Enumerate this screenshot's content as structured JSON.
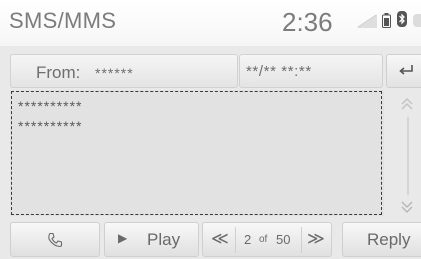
{
  "status_bar": {
    "title": "SMS/MMS",
    "clock": "2:36",
    "signal_icon": "signal-strength-icon",
    "battery_icon": "phone-battery-icon",
    "bluetooth_icon": "bluetooth-icon",
    "bluetooth_glyph": "ʙ"
  },
  "header": {
    "from_label": "From:",
    "from_value": "******",
    "time_value": "**/** **:**",
    "back_icon": "back-arrow-icon"
  },
  "message": {
    "lines": [
      "**********",
      "**********"
    ]
  },
  "scroll": {
    "up_icon": "scroll-up-icon",
    "down_icon": "scroll-down-icon"
  },
  "controls": {
    "call_icon": "phone-handset-icon",
    "play_label": "Play",
    "prev_label": "≪",
    "page_current": "2",
    "page_of": "of",
    "page_total": "50",
    "next_label": "≫",
    "reply_label": "Reply"
  },
  "colors": {
    "background": "#e9e9e9",
    "text": "#6a6a6a",
    "frame": "#3a3a3a"
  }
}
